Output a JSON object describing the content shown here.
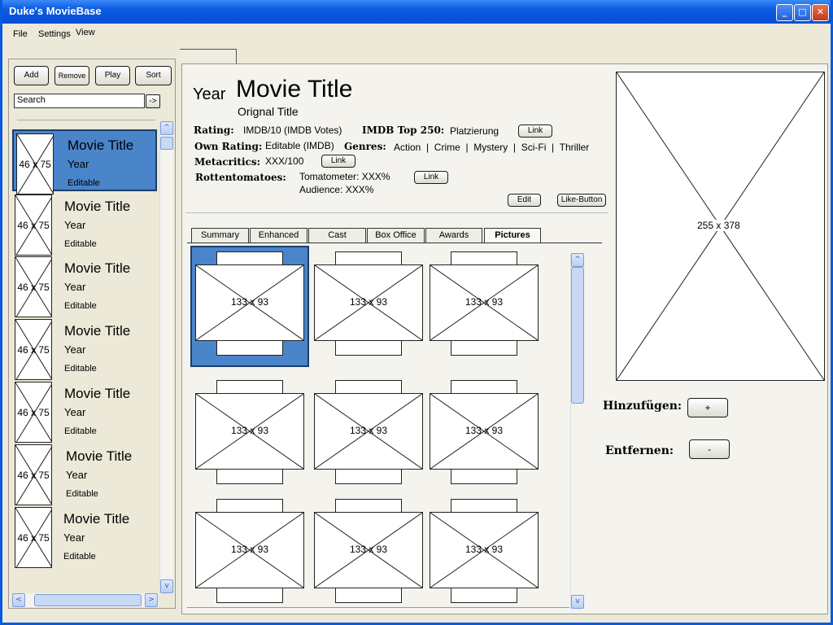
{
  "window": {
    "title": "Duke's MovieBase",
    "min": "_",
    "max": "□",
    "close": "✕"
  },
  "menu": [
    "File",
    "Settings",
    "View"
  ],
  "toolbar": {
    "add": "Add",
    "remove": "Remove",
    "play": "Play",
    "sort": "Sort"
  },
  "search": {
    "value": "Search",
    "go": "->"
  },
  "list": [
    {
      "thumb": "46 x 75",
      "title": "Movie Title",
      "year": "Year",
      "edit": "Editable"
    },
    {
      "thumb": "46 x 75",
      "title": "Movie Title",
      "year": "Year",
      "edit": "Editable"
    },
    {
      "thumb": "46 x 75",
      "title": "Movie Title",
      "year": "Year",
      "edit": "Editable"
    },
    {
      "thumb": "46 x 75",
      "title": "Movie Title",
      "year": "Year",
      "edit": "Editable"
    },
    {
      "thumb": "46 x 75",
      "title": "Movie Title",
      "year": "Year",
      "edit": "Editable"
    },
    {
      "thumb": "46 x 75",
      "title": "Movie Title",
      "year": "Year",
      "edit": "Editable"
    },
    {
      "thumb": "46 x 75",
      "title": "Movie Title",
      "year": "Year",
      "edit": "Editable"
    }
  ],
  "scroll": {
    "up": "^",
    "down": "v",
    "left": "<",
    "right": ">"
  },
  "movie": {
    "year": "Year",
    "title": "Movie Title",
    "original": "Orignal Title",
    "rating_label": "Rating:",
    "rating_value": "IMDB/10 (IMDB Votes)",
    "top250_label": "IMDB Top 250:",
    "top250_value": "Platzierung",
    "own_label": "Own Rating:",
    "own_value": "Editable (IMDB)",
    "genres_label": "Genres:",
    "genres_value": "Action  |  Crime  |  Mystery  |  Sci-Fi  |  Thriller",
    "meta_label": "Metacritics:",
    "meta_value": "XXX/100",
    "rotten_label": "Rottentomatoes:",
    "tomatometer": "Tomatometer: XXX%",
    "audience": "Audience: XXX%",
    "link": "Link",
    "edit": "Edit",
    "like": "Like-Button"
  },
  "tabs": [
    "Summary",
    "Enhanced",
    "Cast",
    "Box Office",
    "Awards",
    "Pictures"
  ],
  "pictures": [
    "133 x 93",
    "133 x 93",
    "133 x 93",
    "133 x 93",
    "133 x 93",
    "133 x 93",
    "133 x 93",
    "133 x 93",
    "133 x 93"
  ],
  "poster": {
    "dim": "255 x 378"
  },
  "actions": {
    "add_label": "Hinzufügen:",
    "add_btn": "+",
    "remove_label": "Entfernen:",
    "remove_btn": "-"
  }
}
